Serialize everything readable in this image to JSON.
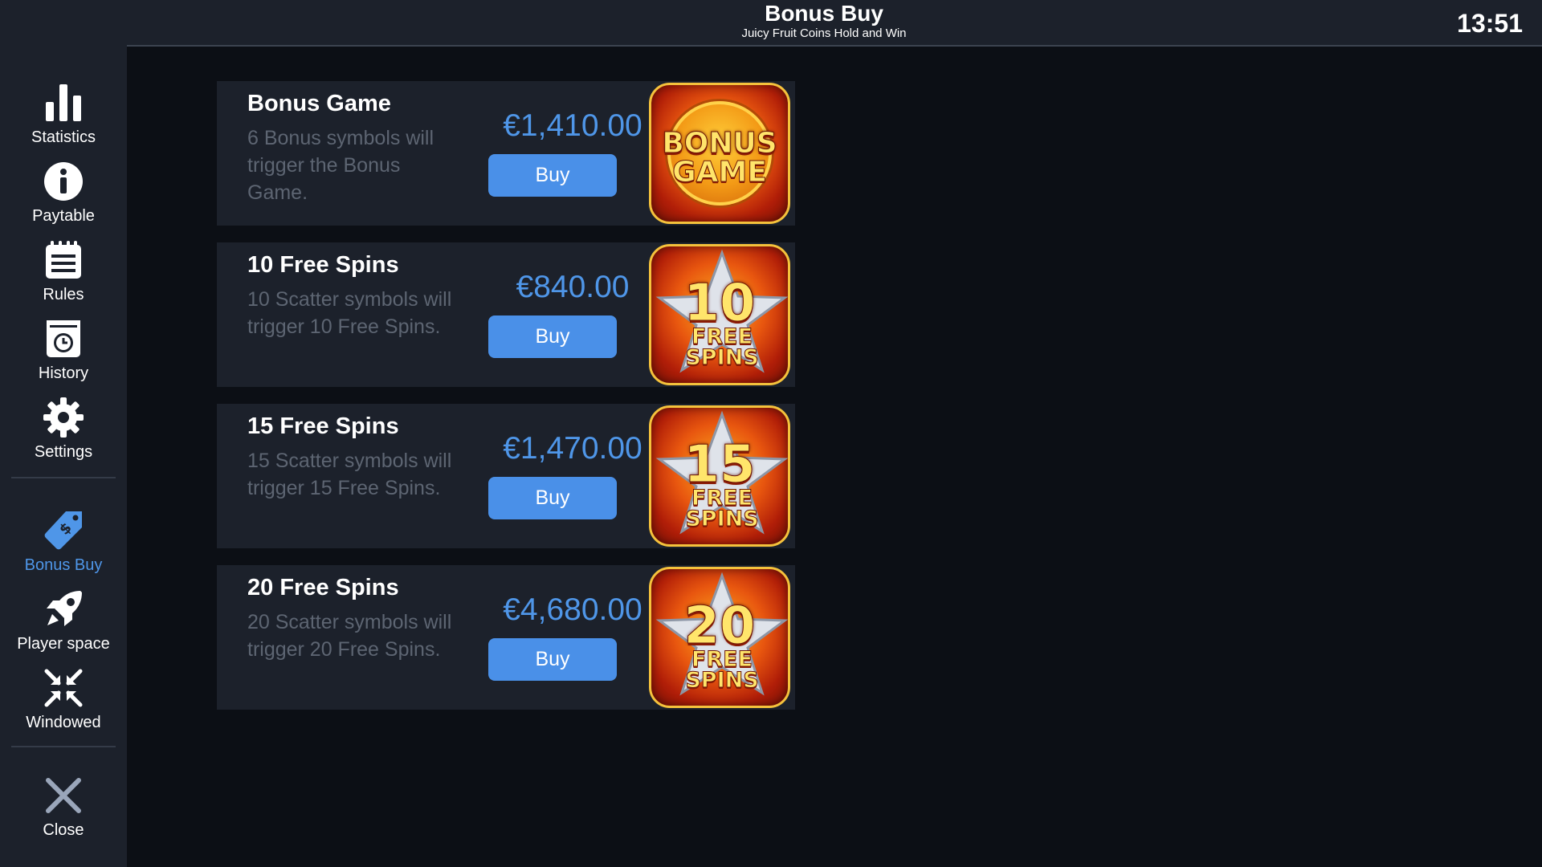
{
  "header": {
    "title": "Bonus Buy",
    "subtitle": "Juicy Fruit Coins Hold and Win",
    "clock": "13:51"
  },
  "sidebar": {
    "items": [
      {
        "label": "Statistics",
        "icon": "bar-chart-icon"
      },
      {
        "label": "Paytable",
        "icon": "info-icon"
      },
      {
        "label": "Rules",
        "icon": "notepad-icon"
      },
      {
        "label": "History",
        "icon": "history-clock-icon"
      },
      {
        "label": "Settings",
        "icon": "gear-icon"
      },
      {
        "label": "Bonus Buy",
        "icon": "price-tag-icon",
        "active": true
      },
      {
        "label": "Player space",
        "icon": "rocket-icon"
      },
      {
        "label": "Windowed",
        "icon": "collapse-arrows-icon"
      },
      {
        "label": "Close",
        "icon": "close-icon"
      }
    ]
  },
  "offers": [
    {
      "title": "Bonus Game",
      "description": "6 Bonus symbols will trigger the Bonus Game.",
      "price": "€1,410.00",
      "buy_label": "Buy",
      "badge_top": "BONUS",
      "badge_bottom": "GAME"
    },
    {
      "title": "10 Free Spins",
      "description": "10 Scatter symbols will trigger 10 Free Spins.",
      "price": "€840.00",
      "buy_label": "Buy",
      "badge_top": "10",
      "badge_bottom": "FREE SPINS"
    },
    {
      "title": "15 Free Spins",
      "description": "15 Scatter symbols will trigger 15 Free Spins.",
      "price": "€1,470.00",
      "buy_label": "Buy",
      "badge_top": "15",
      "badge_bottom": "FREE SPINS"
    },
    {
      "title": "20 Free Spins",
      "description": "20 Scatter symbols will trigger 20 Free Spins.",
      "price": "€4,680.00",
      "buy_label": "Buy",
      "badge_top": "20",
      "badge_bottom": "FREE SPINS"
    }
  ],
  "colors": {
    "accent": "#4f96e8",
    "panel": "#1c212b",
    "background": "#0c0f15"
  }
}
